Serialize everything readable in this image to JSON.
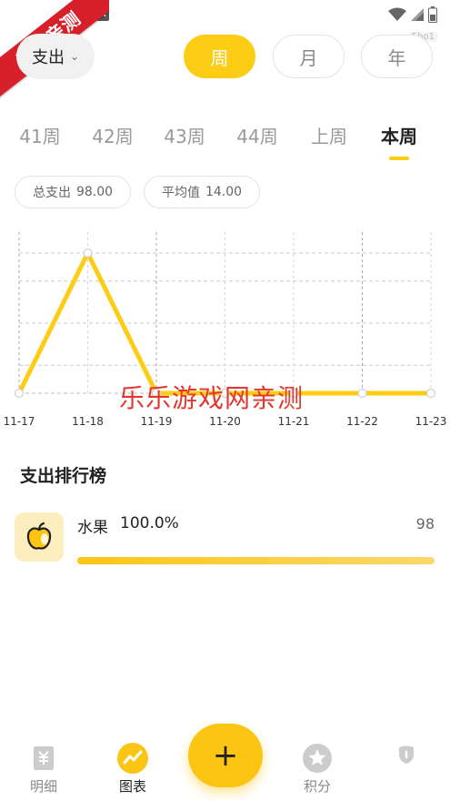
{
  "status_bar": {
    "notification_badge": "A"
  },
  "ribbon": {
    "text": "乐乐亲测"
  },
  "corner_badge": "5bo1",
  "header": {
    "type_select": {
      "label": "支出",
      "icon": "chevron-down-icon"
    },
    "period_tabs": [
      {
        "label": "周",
        "active": true
      },
      {
        "label": "月",
        "active": false
      },
      {
        "label": "年",
        "active": false
      }
    ]
  },
  "week_tabs": [
    {
      "label": "41周",
      "active": false
    },
    {
      "label": "42周",
      "active": false
    },
    {
      "label": "43周",
      "active": false
    },
    {
      "label": "44周",
      "active": false
    },
    {
      "label": "上周",
      "active": false
    },
    {
      "label": "本周",
      "active": true
    }
  ],
  "summary": {
    "total": {
      "label": "总支出",
      "value": "98.00"
    },
    "average": {
      "label": "平均值",
      "value": "14.00"
    }
  },
  "chart_data": {
    "type": "line",
    "categories": [
      "11-17",
      "11-18",
      "11-19",
      "11-20",
      "11-21",
      "11-22",
      "11-23"
    ],
    "series": [
      {
        "values": [
          0,
          98,
          0,
          0,
          0,
          0,
          0
        ]
      }
    ],
    "ylim": [
      0,
      98
    ],
    "grid": true,
    "color": "#fccd14"
  },
  "watermark": "乐乐游戏网亲测",
  "ranking": {
    "title": "支出排行榜",
    "items": [
      {
        "name": "水果",
        "percent": "100.0%",
        "amount": "98",
        "fraction": 1.0,
        "icon": "apple-icon"
      }
    ]
  },
  "bottom_nav": {
    "items": [
      {
        "label": "明细",
        "icon": "receipt-icon",
        "active": false
      },
      {
        "label": "图表",
        "icon": "chart-icon",
        "active": true
      },
      {
        "label": "积分",
        "icon": "star-icon",
        "active": false
      },
      {
        "label": "",
        "icon": "profile-icon",
        "active": false
      }
    ],
    "add_button": {
      "label": "+"
    }
  },
  "colors": {
    "accent": "#fccd14",
    "watermark": "#e2362e",
    "ribbon": "#d8202a"
  }
}
